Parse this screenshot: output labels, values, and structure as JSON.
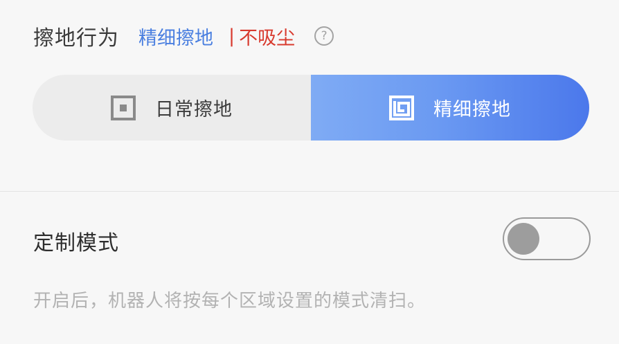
{
  "header": {
    "title": "擦地行为",
    "mode_name": "精细擦地",
    "separator": "|",
    "warning": "不吸尘",
    "help_glyph": "?"
  },
  "segment": {
    "options": [
      {
        "label": "日常擦地",
        "icon": "square-dot-icon",
        "selected": false
      },
      {
        "label": "精细擦地",
        "icon": "square-spiral-icon",
        "selected": true
      }
    ]
  },
  "custom_mode": {
    "title": "定制模式",
    "enabled": false,
    "description": "开启后，机器人将按每个区域设置的模式清扫。"
  },
  "colors": {
    "accent_blue": "#4a7fe0",
    "warning_red": "#d83a2e",
    "gradient_start": "#7fabf4",
    "gradient_end": "#4b78eb"
  }
}
